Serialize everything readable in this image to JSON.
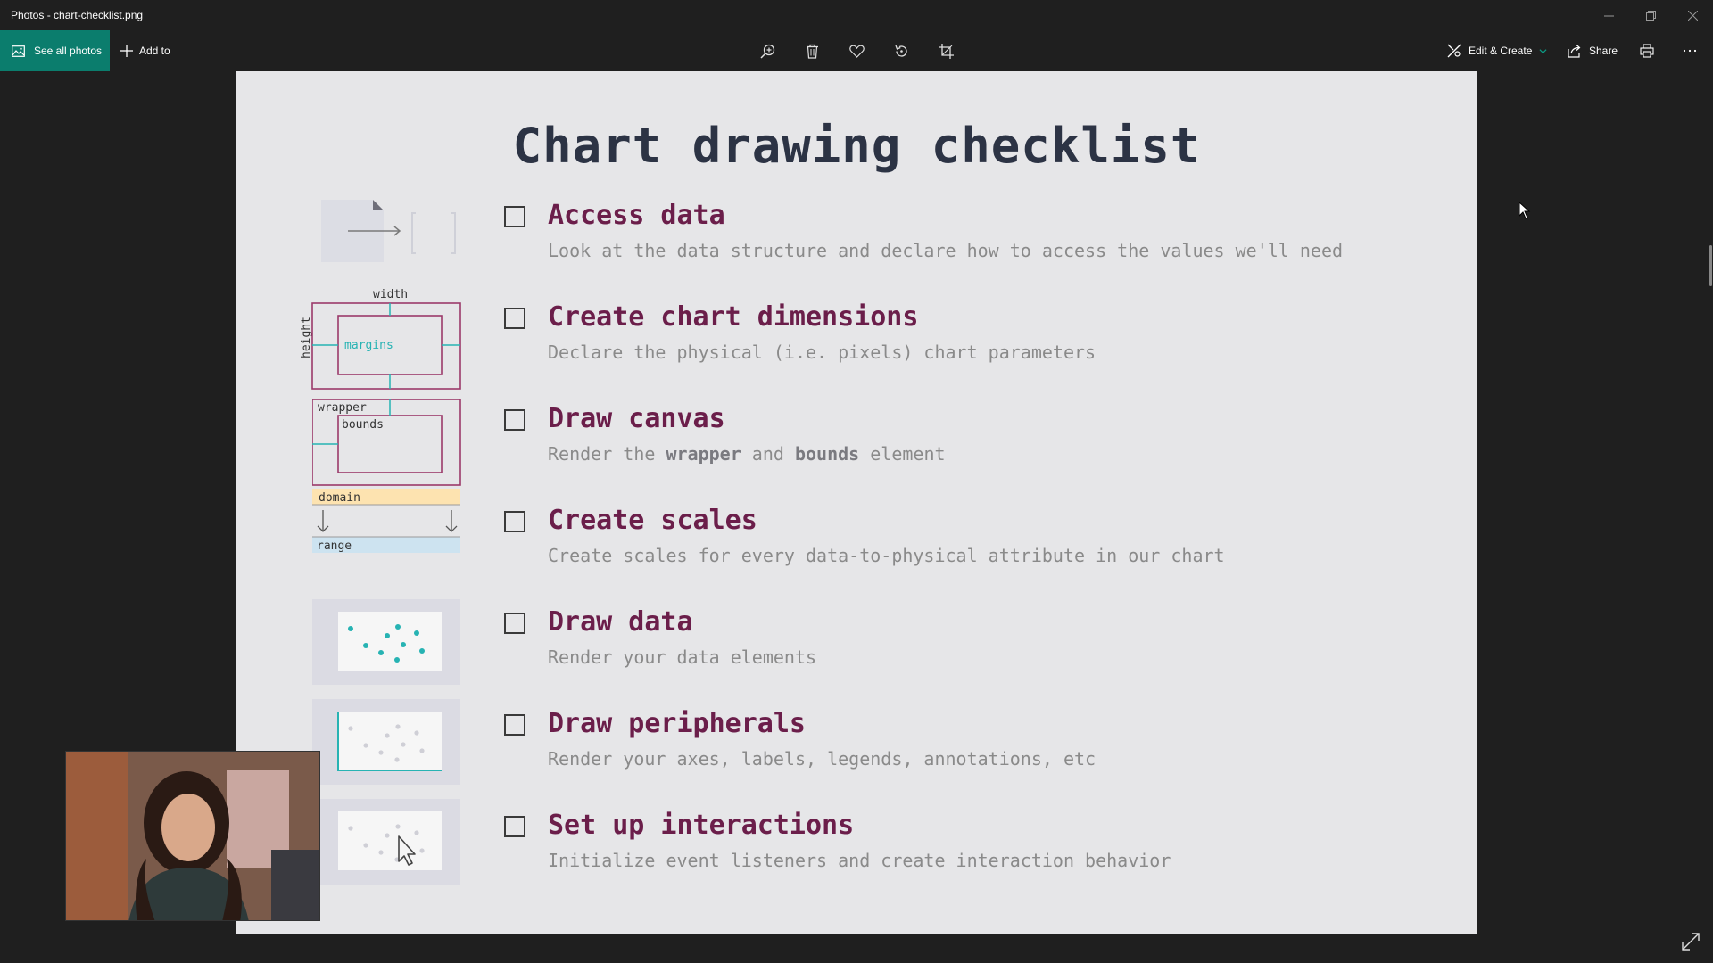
{
  "window": {
    "title": "Photos - chart-checklist.png"
  },
  "toolbar": {
    "see_all_label": "See all photos",
    "add_to_label": "Add to",
    "edit_create_label": "Edit & Create",
    "share_label": "Share",
    "center_icons": [
      "zoom-icon",
      "delete-icon",
      "favorite-icon",
      "rotate-icon",
      "crop-icon"
    ]
  },
  "slide": {
    "title": "Chart drawing checklist",
    "illustration_labels": {
      "width": "width",
      "height": "height",
      "margins": "margins",
      "wrapper": "wrapper",
      "bounds": "bounds",
      "domain": "domain",
      "range": "range"
    },
    "items": [
      {
        "title": "Access data",
        "description": "Look at the data structure and declare how to access the values we'll need"
      },
      {
        "title": "Create chart dimensions",
        "description": "Declare the physical (i.e. pixels) chart parameters"
      },
      {
        "title": "Draw canvas",
        "desc_prefix": "Render the ",
        "desc_bold1": "wrapper",
        "desc_mid": " and ",
        "desc_bold2": "bounds",
        "desc_suffix": " element"
      },
      {
        "title": "Create scales",
        "description": "Create scales for every data-to-physical attribute in our chart"
      },
      {
        "title": "Draw data",
        "description": "Render your data elements"
      },
      {
        "title": "Draw peripherals",
        "description": "Render your axes, labels, legends, annotations, etc"
      },
      {
        "title": "Set up interactions",
        "description": "Initialize event listeners and create interaction behavior"
      }
    ]
  },
  "colors": {
    "accent": "#0b7d6d",
    "title_text": "#2c3344",
    "item_title": "#6b1e4a",
    "illus_box": "#9b3a6a",
    "illus_teal": "#27b3b3",
    "domain_bg": "#fde3b0",
    "range_bg": "#cde3f0"
  }
}
